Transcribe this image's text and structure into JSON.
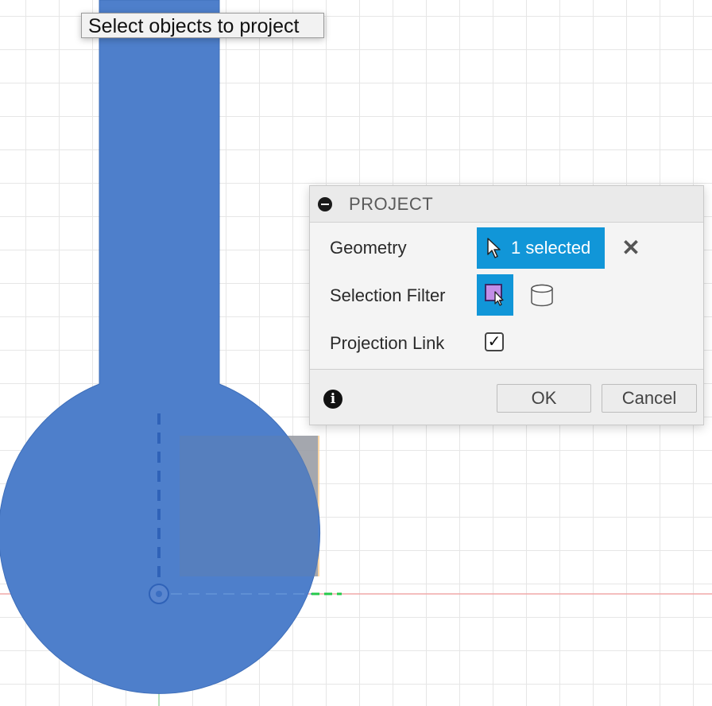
{
  "tooltip": {
    "text": "Select objects to project"
  },
  "dialog": {
    "title": "PROJECT",
    "geometry_label": "Geometry",
    "geometry_value": "1 selected",
    "selection_filter_label": "Selection Filter",
    "projection_link_label": "Projection Link",
    "projection_link_checked": true,
    "check_glyph": "✓",
    "ok_label": "OK",
    "cancel_label": "Cancel",
    "clear_glyph": "✕",
    "info_glyph": "i"
  },
  "icons": {
    "collapse": "minus-circle-icon",
    "geometry": "arrow-cursor-icon",
    "clear": "close-icon",
    "filter_face": "face-select-icon",
    "filter_body": "body-cylinder-icon",
    "info": "info-icon"
  },
  "colors": {
    "sketch_fill": "#4e7fcb",
    "accent": "#1196d8",
    "highlight": "#f8c98a",
    "axis_green": "#26c94a",
    "axis_red": "#e86a6a"
  }
}
